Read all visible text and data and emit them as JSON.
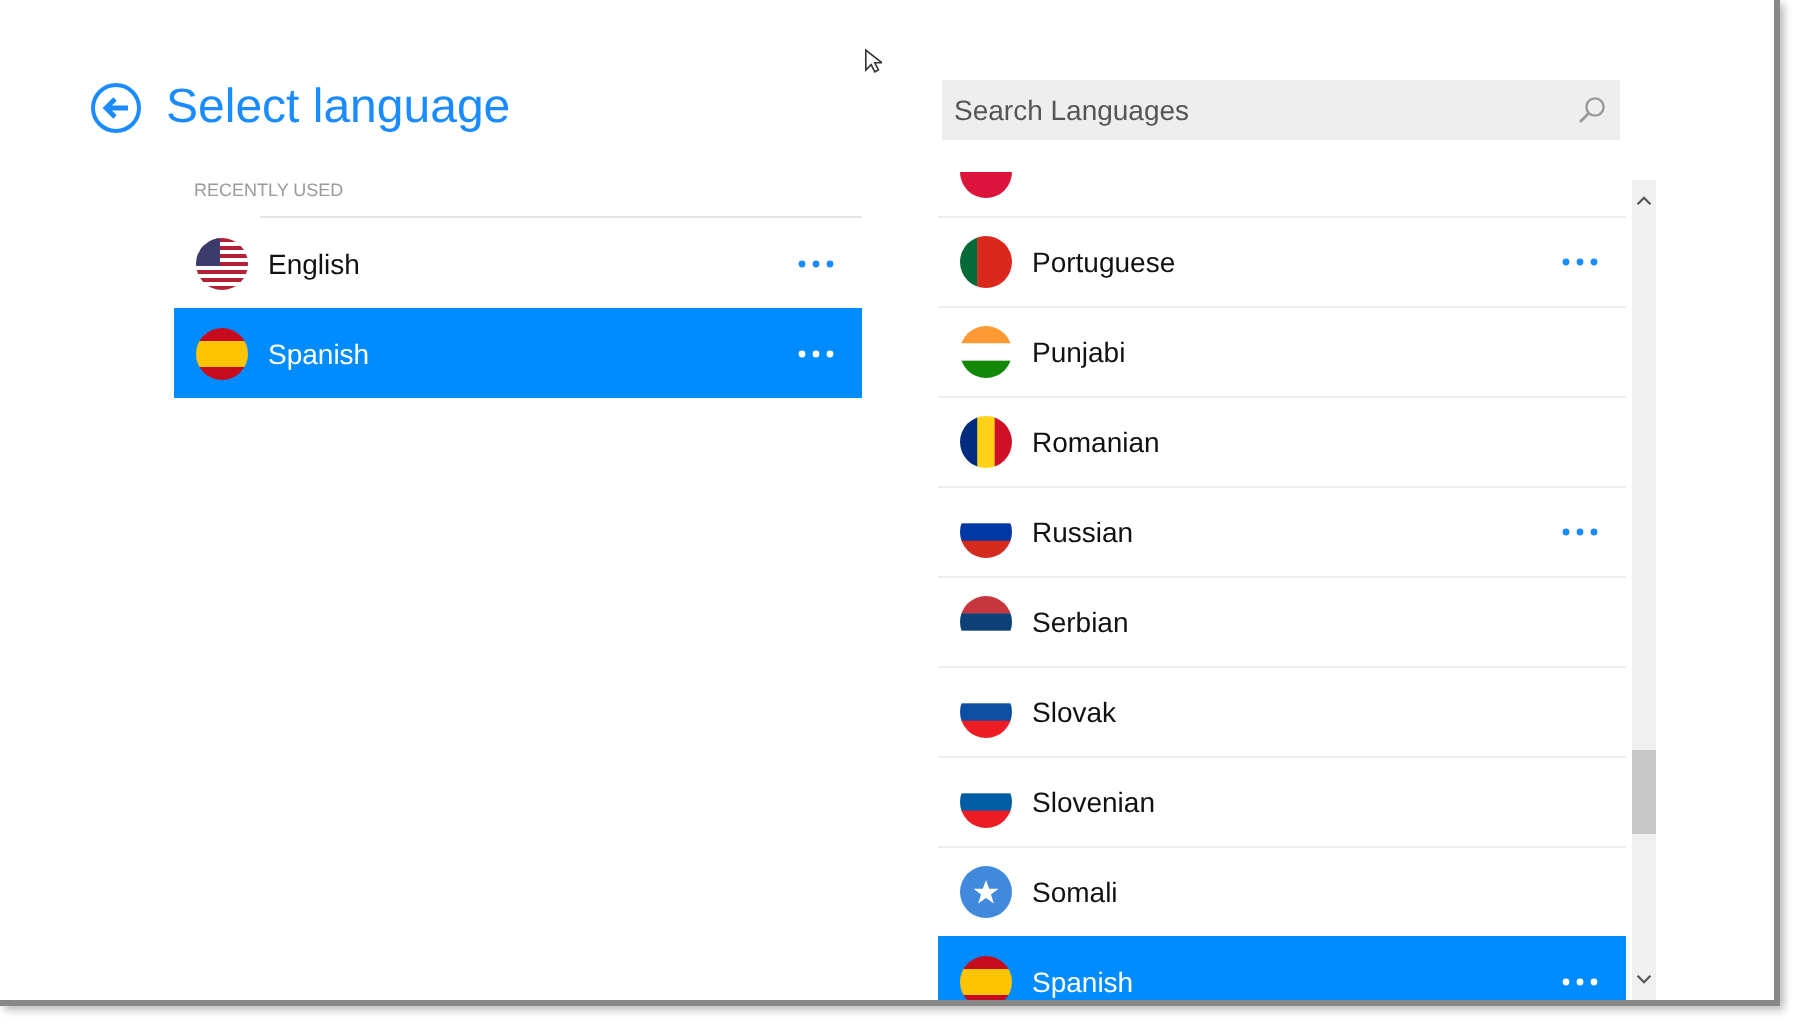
{
  "title": "Select language",
  "recent": {
    "heading": "RECENTLY USED",
    "items": [
      {
        "name": "English",
        "selected": false,
        "has_menu": true,
        "kind": "us"
      },
      {
        "name": "Spanish",
        "selected": true,
        "has_menu": true,
        "kind": "spain"
      }
    ]
  },
  "search": {
    "placeholder": "Search Languages"
  },
  "languages": [
    {
      "selected": false,
      "has_menu": false,
      "kind": "poland"
    },
    {
      "name": "Portuguese",
      "selected": false,
      "has_menu": true,
      "kind": "portugal"
    },
    {
      "name": "Punjabi",
      "selected": false,
      "has_menu": false,
      "kind": "india"
    },
    {
      "name": "Romanian",
      "selected": false,
      "has_menu": false,
      "kind": "romania"
    },
    {
      "name": "Russian",
      "selected": false,
      "has_menu": true,
      "kind": "russia"
    },
    {
      "name": "Serbian",
      "selected": false,
      "has_menu": false,
      "kind": "serbia"
    },
    {
      "name": "Slovak",
      "selected": false,
      "has_menu": false,
      "kind": "slovakia"
    },
    {
      "name": "Slovenian",
      "selected": false,
      "has_menu": false,
      "kind": "slovenia"
    },
    {
      "name": "Somali",
      "selected": false,
      "has_menu": false,
      "kind": "somalia"
    },
    {
      "name": "Spanish",
      "selected": true,
      "has_menu": true,
      "kind": "spain"
    }
  ]
}
